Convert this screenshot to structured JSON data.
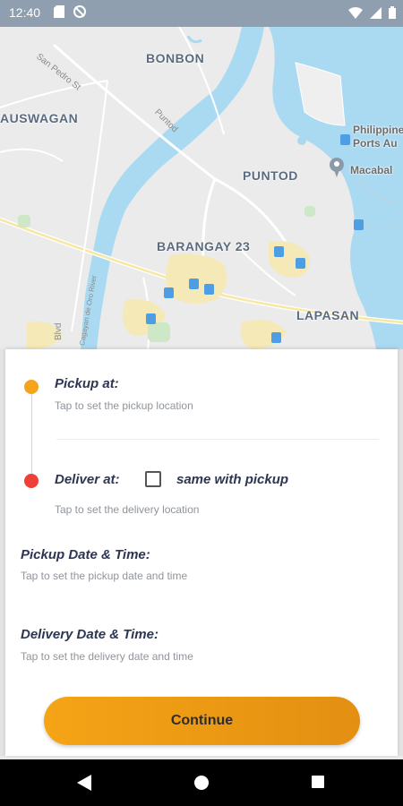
{
  "status_bar": {
    "time": "12:40"
  },
  "map": {
    "labels": {
      "bonbon": "BONBON",
      "auswagan": "AUSWAGAN",
      "puntod": "PUNTOD",
      "barangay23": "BARANGAY 23",
      "lapasan": "LAPASAN",
      "philippine_ports": "Philippine\nPorts Au",
      "macabalan": "Macabal"
    },
    "streets": {
      "san_pedro": "San Pedro St",
      "puntod_rd": "Puntod",
      "river": "Cagayan de Oro River",
      "blvd": "Blvd"
    }
  },
  "sheet": {
    "pickup_label": "Pickup at:",
    "pickup_hint": "Tap to set the pickup location",
    "deliver_label": "Deliver at:",
    "same_with_pickup": "same with pickup",
    "deliver_hint": "Tap to set the delivery location",
    "pickup_datetime_label": "Pickup Date & Time:",
    "pickup_datetime_hint": "Tap to set the pickup date and time",
    "delivery_datetime_label": "Delivery Date & Time:",
    "delivery_datetime_hint": "Tap to set the delivery date and time",
    "continue_label": "Continue"
  },
  "colors": {
    "accent_orange": "#f5a31b",
    "deliver_red": "#ee4038",
    "label_navy": "#2d3550"
  }
}
